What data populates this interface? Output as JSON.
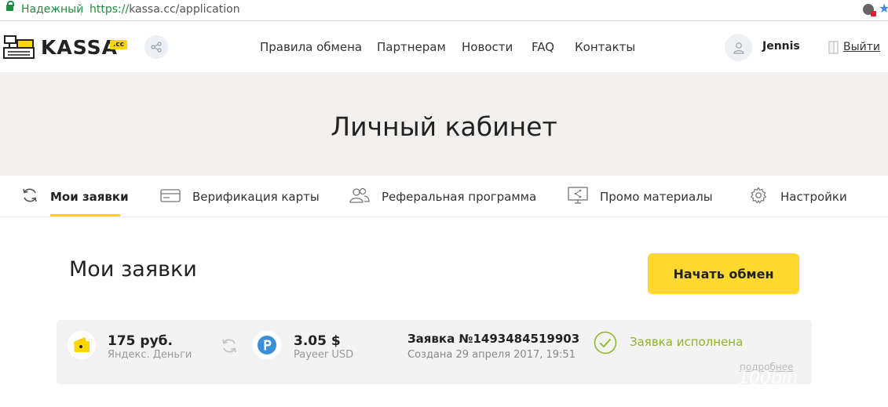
{
  "browser": {
    "secure_label": "Надежный",
    "url_scheme": "https://",
    "url_rest": "kassa.cc/application"
  },
  "header": {
    "logo_text": "KASSA",
    "logo_suffix": ".cc",
    "nav": [
      "Правила обмена",
      "Партнерам",
      "Новости",
      "FAQ",
      "Контакты"
    ],
    "username": "Jennis",
    "logout_label": "Выйти"
  },
  "hero": {
    "title": "Личный кабинет"
  },
  "tabs": [
    {
      "label": "Мои заявки",
      "icon": "refresh-icon",
      "active": true
    },
    {
      "label": "Верификация карты",
      "icon": "card-icon",
      "active": false
    },
    {
      "label": "Реферальная программа",
      "icon": "users-icon",
      "active": false
    },
    {
      "label": "Промо материалы",
      "icon": "monitor-share-icon",
      "active": false
    },
    {
      "label": "Настройки",
      "icon": "gear-icon",
      "active": false
    }
  ],
  "main": {
    "title": "Мои заявки",
    "start_button": "Начать обмен"
  },
  "order": {
    "from_amount": "175 руб.",
    "from_currency": "Яндекс. Деньги",
    "to_amount": "3.05 $",
    "to_currency": "Payeer USD",
    "number": "Заявка №1493484519903",
    "created": "Создана 29 апреля 2017, 19:51",
    "status": "Заявка исполнена",
    "more_label": "подробнее"
  },
  "watermark": "100bin",
  "colors": {
    "accent": "#ffd930",
    "success": "#8cb52a",
    "payeer": "#3a8fd8"
  }
}
